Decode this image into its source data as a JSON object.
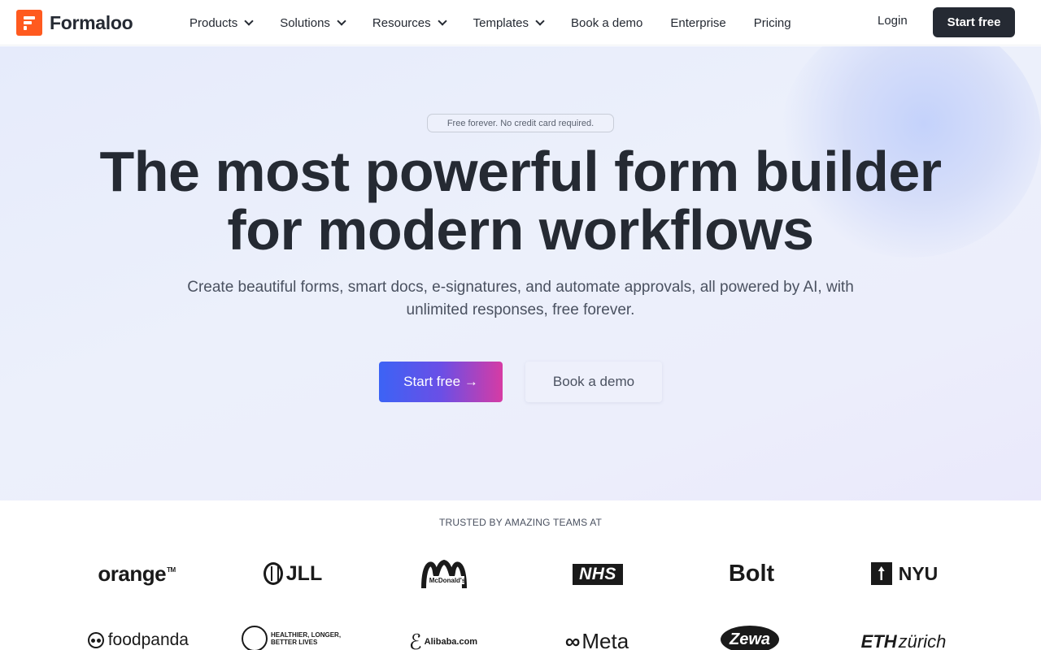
{
  "nav": {
    "brand": "Formaloo",
    "menu": [
      {
        "label": "Products",
        "dropdown": true
      },
      {
        "label": "Solutions",
        "dropdown": true
      },
      {
        "label": "Resources",
        "dropdown": true
      },
      {
        "label": "Templates",
        "dropdown": true
      },
      {
        "label": "Book a demo",
        "dropdown": false
      },
      {
        "label": "Enterprise",
        "dropdown": false
      },
      {
        "label": "Pricing",
        "dropdown": false
      }
    ],
    "login": "Login",
    "cta": "Start free"
  },
  "hero": {
    "badge": "Free forever. No credit card required.",
    "headline_line1": "The most powerful form builder",
    "headline_line2": "for modern workflows",
    "subheading": "Create beautiful forms, smart docs, e-signatures, and automate approvals, all powered by AI, with unlimited responses, free forever.",
    "primary_cta": "Start free →",
    "secondary_cta": "Book a demo"
  },
  "trusted": {
    "heading": "TRUSTED BY AMAZING TEAMS AT",
    "logos": {
      "orange": "orange",
      "orange_tm": "TM",
      "jll": "JLL",
      "mcdonalds": "McDonald's",
      "nhs": "NHS",
      "bolt": "Bolt",
      "nyu": "NYU",
      "foodpanda": "foodpanda",
      "aia_line1": "HEALTHIER, LONGER,",
      "aia_line2": "BETTER LIVES",
      "alibaba": "Alibaba.com",
      "meta": "Meta",
      "zewa": "Zewa",
      "eth_bold": "ETH",
      "eth_rest": "zürich"
    }
  },
  "colors": {
    "brand_orange": "#ff5a1f",
    "dark": "#252a33",
    "gradient_start": "#3c63f5",
    "gradient_end": "#d63ba4",
    "hero_bg": "#e8ecfb"
  }
}
